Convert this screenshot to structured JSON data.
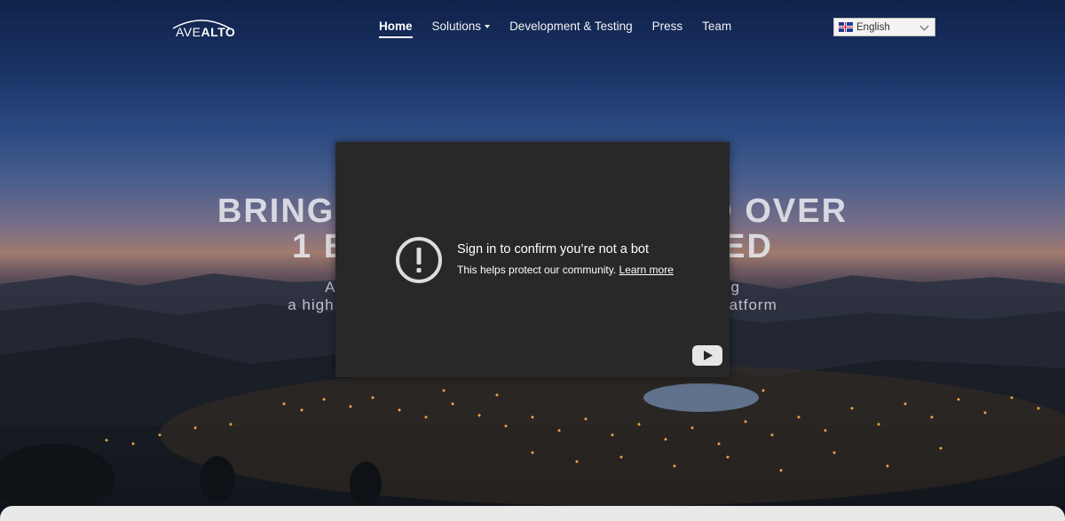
{
  "logo": {
    "text_light": "AVE",
    "text_bold": "ALTO"
  },
  "nav": {
    "items": [
      {
        "label": "Home",
        "active": true
      },
      {
        "label": "Solutions",
        "has_dropdown": true
      },
      {
        "label": "Development & Testing"
      },
      {
        "label": "Press"
      },
      {
        "label": "Team"
      }
    ]
  },
  "language": {
    "selected": "English",
    "flag_icon": "uk-flag-icon"
  },
  "hero": {
    "headline_line1_left": "BRING",
    "headline_line1_right": "D OVER",
    "headline_line2_left": "1 B",
    "headline_line2_right": "ED",
    "sub_line1_left": "A",
    "sub_line1_right": "g",
    "sub_line2_left": "a high",
    "sub_line2_right": "atform"
  },
  "video_overlay": {
    "title": "Sign in to confirm you’re not a bot",
    "body": "This helps protect our community.",
    "link": "Learn more",
    "icons": [
      "alert-circle-icon",
      "youtube-icon"
    ],
    "background_color": "#282828"
  },
  "colors": {
    "accent": "#ffffff",
    "footer": "#e9e9e9"
  }
}
